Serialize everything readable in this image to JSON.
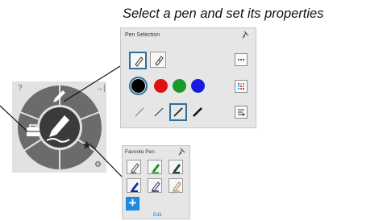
{
  "caption": "Select a pen and set its properties",
  "pen_panel": {
    "title": "Pen Selection",
    "colors": [
      "#000000",
      "#e01010",
      "#1a9a2a",
      "#1a1ae6"
    ],
    "selected_color_index": 0
  },
  "radial_menu": {
    "help_glyph": "?",
    "pin_glyph": "→|",
    "gear_glyph": "⚙",
    "star_glyph": "★"
  },
  "favorite_panel": {
    "title": "Favorite Pen",
    "add_glyph": "+",
    "edit_label": "Edit"
  }
}
